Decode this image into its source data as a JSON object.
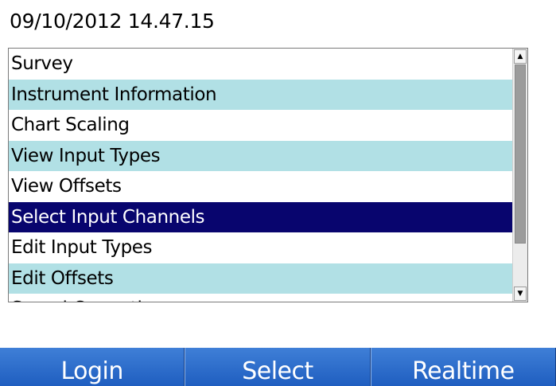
{
  "header": {
    "timestamp": "09/10/2012 14.47.15"
  },
  "menu": {
    "items": [
      {
        "label": "Survey",
        "style": "normal"
      },
      {
        "label": "Instrument Information",
        "style": "alt"
      },
      {
        "label": "Chart Scaling",
        "style": "normal"
      },
      {
        "label": "View Input Types",
        "style": "alt"
      },
      {
        "label": "View Offsets",
        "style": "normal"
      },
      {
        "label": "Select Input Channels",
        "style": "selected"
      },
      {
        "label": "Edit Input Types",
        "style": "normal"
      },
      {
        "label": "Edit Offsets",
        "style": "alt"
      },
      {
        "label": "Sound Correction",
        "style": "normal"
      }
    ],
    "scroll_up_icon": "▲",
    "scroll_down_icon": "▼"
  },
  "bottom_bar": {
    "login_label": "Login",
    "select_label": "Select",
    "realtime_label": "Realtime"
  },
  "colors": {
    "alt_row": "#b1e0e5",
    "selected_row": "#08056e",
    "button": "#2a6ad0"
  }
}
